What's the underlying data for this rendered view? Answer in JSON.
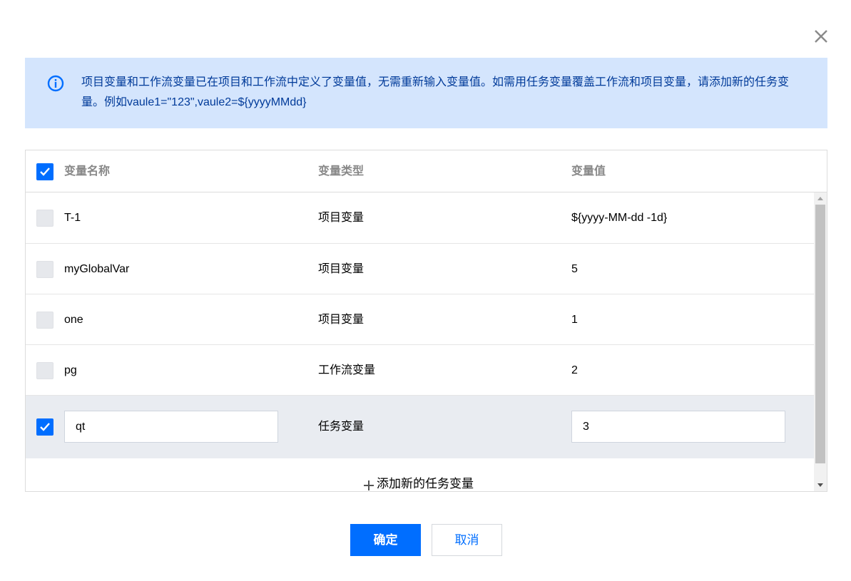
{
  "dialog": {
    "notice_text": "项目变量和工作流变量已在项目和工作流中定义了变量值，无需重新输入变量值。如需用任务变量覆盖工作流和项目变量，请添加新的任务变量。例如vaule1=\"123\",vaule2=${yyyyMMdd}",
    "close_icon": "close-icon",
    "info_icon": "info-icon"
  },
  "table": {
    "headers": {
      "name": "变量名称",
      "type": "变量类型",
      "value": "变量值"
    },
    "header_checked": true,
    "rows": [
      {
        "checked": false,
        "name": "T-1",
        "type": "项目变量",
        "value": "${yyyy-MM-dd -1d}"
      },
      {
        "checked": false,
        "name": "myGlobalVar",
        "type": "项目变量",
        "value": "5"
      },
      {
        "checked": false,
        "name": "one",
        "type": "项目变量",
        "value": "1"
      },
      {
        "checked": false,
        "name": "pg",
        "type": "工作流变量",
        "value": "2"
      },
      {
        "checked": true,
        "name": "qt",
        "type": "任务变量",
        "value": "3",
        "editable": true
      }
    ],
    "add_label": "添加新的任务变量"
  },
  "buttons": {
    "ok": "确定",
    "cancel": "取消"
  },
  "colors": {
    "accent": "#006eff",
    "notice_bg": "#d4e5fd",
    "notice_text": "#003a99"
  }
}
